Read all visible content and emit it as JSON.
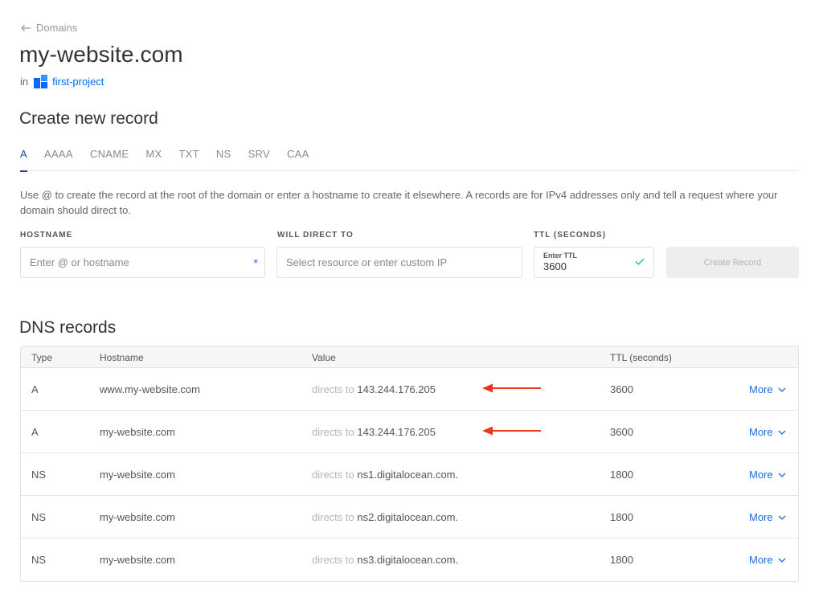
{
  "breadcrumb": {
    "back_label": "Domains"
  },
  "domain": {
    "name": "my-website.com",
    "in_label": "in",
    "project": "first-project"
  },
  "create": {
    "title": "Create new record",
    "tabs": [
      "A",
      "AAAA",
      "CNAME",
      "MX",
      "TXT",
      "NS",
      "SRV",
      "CAA"
    ],
    "active_tab": "A",
    "help_text": "Use @ to create the record at the root of the domain or enter a hostname to create it elsewhere. A records are for IPv4 addresses only and tell a request where your domain should direct to.",
    "hostname": {
      "label": "HOSTNAME",
      "placeholder": "Enter @ or hostname",
      "required_mark": "*"
    },
    "direct": {
      "label": "WILL DIRECT TO",
      "placeholder": "Select resource or enter custom IP"
    },
    "ttl": {
      "label": "TTL (SECONDS)",
      "small_label": "Enter TTL",
      "value": "3600"
    },
    "button": "Create Record"
  },
  "records": {
    "title": "DNS records",
    "columns": {
      "type": "Type",
      "hostname": "Hostname",
      "value": "Value",
      "ttl": "TTL (seconds)"
    },
    "directs_label": "directs to",
    "more_label": "More",
    "rows": [
      {
        "type": "A",
        "hostname": "www.my-website.com",
        "value": "143.244.176.205",
        "ttl": "3600",
        "annotated": true
      },
      {
        "type": "A",
        "hostname": "my-website.com",
        "value": "143.244.176.205",
        "ttl": "3600",
        "annotated": true
      },
      {
        "type": "NS",
        "hostname": "my-website.com",
        "value": "ns1.digitalocean.com.",
        "ttl": "1800",
        "annotated": false
      },
      {
        "type": "NS",
        "hostname": "my-website.com",
        "value": "ns2.digitalocean.com.",
        "ttl": "1800",
        "annotated": false
      },
      {
        "type": "NS",
        "hostname": "my-website.com",
        "value": "ns3.digitalocean.com.",
        "ttl": "1800",
        "annotated": false
      }
    ]
  },
  "colors": {
    "accent": "#0069ff",
    "link": "#1b6bd6",
    "tab_active": "#1b4b9a",
    "annotation_arrow": "#e8371a"
  },
  "icons": {
    "back": "arrow-left-icon",
    "project": "project-icon",
    "check": "check-icon",
    "more": "chevron-down-icon"
  }
}
